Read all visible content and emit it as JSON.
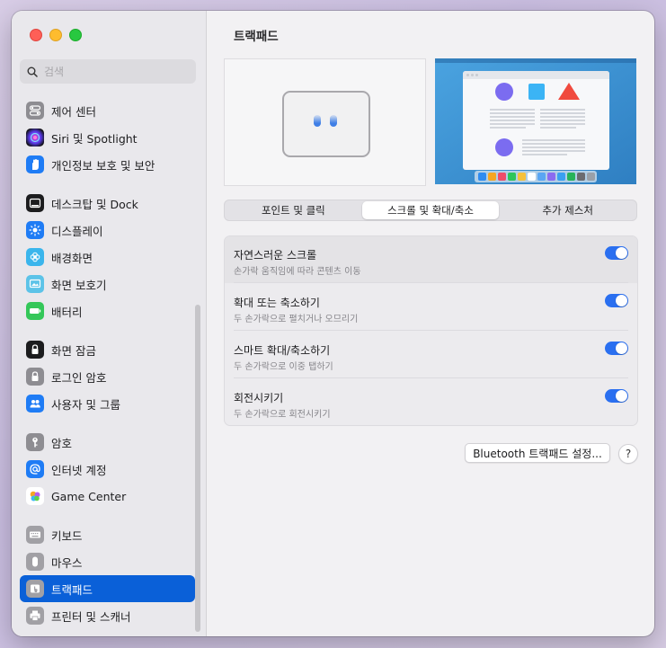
{
  "window": {
    "title": "트랙패드"
  },
  "search": {
    "placeholder": "검색"
  },
  "sidebar": {
    "items": [
      {
        "label": "제어 센터",
        "icon": "control-center-icon"
      },
      {
        "label": "Siri 및 Spotlight",
        "icon": "siri-icon"
      },
      {
        "label": "개인정보 보호 및 보안",
        "icon": "hand-icon"
      },
      {
        "label": "데스크탑 및 Dock",
        "icon": "desktop-dock-icon"
      },
      {
        "label": "디스플레이",
        "icon": "display-icon"
      },
      {
        "label": "배경화면",
        "icon": "wallpaper-icon"
      },
      {
        "label": "화면 보호기",
        "icon": "screensaver-icon"
      },
      {
        "label": "배터리",
        "icon": "battery-icon"
      },
      {
        "label": "화면 잠금",
        "icon": "lock-icon"
      },
      {
        "label": "로그인 암호",
        "icon": "login-password-icon"
      },
      {
        "label": "사용자 및 그룹",
        "icon": "users-icon"
      },
      {
        "label": "암호",
        "icon": "key-icon"
      },
      {
        "label": "인터넷 계정",
        "icon": "at-icon"
      },
      {
        "label": "Game Center",
        "icon": "game-center-icon"
      },
      {
        "label": "키보드",
        "icon": "keyboard-icon"
      },
      {
        "label": "마우스",
        "icon": "mouse-icon"
      },
      {
        "label": "트랙패드",
        "icon": "trackpad-icon",
        "selected": true
      },
      {
        "label": "프린터 및 스캐너",
        "icon": "printer-icon"
      }
    ]
  },
  "tabs": [
    {
      "label": "포인트 및 클릭"
    },
    {
      "label": "스크롤 및 확대/축소",
      "active": true
    },
    {
      "label": "추가 제스처"
    }
  ],
  "options": [
    {
      "title": "자연스러운 스크롤",
      "desc": "손가락 움직임에 따라 콘텐츠 이동",
      "on": true
    },
    {
      "title": "확대 또는 축소하기",
      "desc": "두 손가락으로 펼치거나 오므리기",
      "on": true
    },
    {
      "title": "스마트 확대/축소하기",
      "desc": "두 손가락으로 이중 탭하기",
      "on": true
    },
    {
      "title": "회전시키기",
      "desc": "두 손가락으로 회전시키기",
      "on": true
    }
  ],
  "buttons": {
    "bluetooth": "Bluetooth 트랙패드 설정...",
    "help": "?"
  },
  "colors": {
    "accent": "#0a60d8",
    "toggle_on": "#2a6ff0"
  }
}
